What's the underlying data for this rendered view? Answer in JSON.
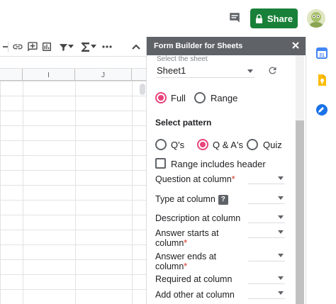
{
  "topbar": {
    "share_label": "Share",
    "colors": {
      "share_bg": "#188038",
      "share_text": "#ffffff"
    }
  },
  "grid": {
    "columns": [
      "I",
      "J"
    ]
  },
  "sidebar": {
    "title": "Form Builder for Sheets",
    "select_sheet_label": "Select the sheet",
    "sheet_value": "Sheet1",
    "mode_options": [
      {
        "label": "Full",
        "selected": true
      },
      {
        "label": "Range",
        "selected": false
      }
    ],
    "select_pattern_title": "Select pattern",
    "pattern_options": [
      {
        "label": "Q's",
        "selected": false
      },
      {
        "label": "Q & A's",
        "selected": true
      },
      {
        "label": "Quiz",
        "selected": false
      }
    ],
    "range_header_label": "Range includes header",
    "fields": [
      {
        "label": "Question at column",
        "required": "*"
      },
      {
        "label": "Type at column",
        "help": "?"
      },
      {
        "label": "Description at column"
      },
      {
        "label_line1": "Answer starts at",
        "label_line2": "column",
        "required": "*"
      },
      {
        "label_line1": "Answer ends at",
        "label_line2": "column",
        "required": "*"
      },
      {
        "label": "Required at column"
      },
      {
        "label": "Add other at column"
      }
    ],
    "colors": {
      "header_bg": "#5f6368",
      "accent": "#e8437a",
      "required": "#d93025"
    }
  }
}
